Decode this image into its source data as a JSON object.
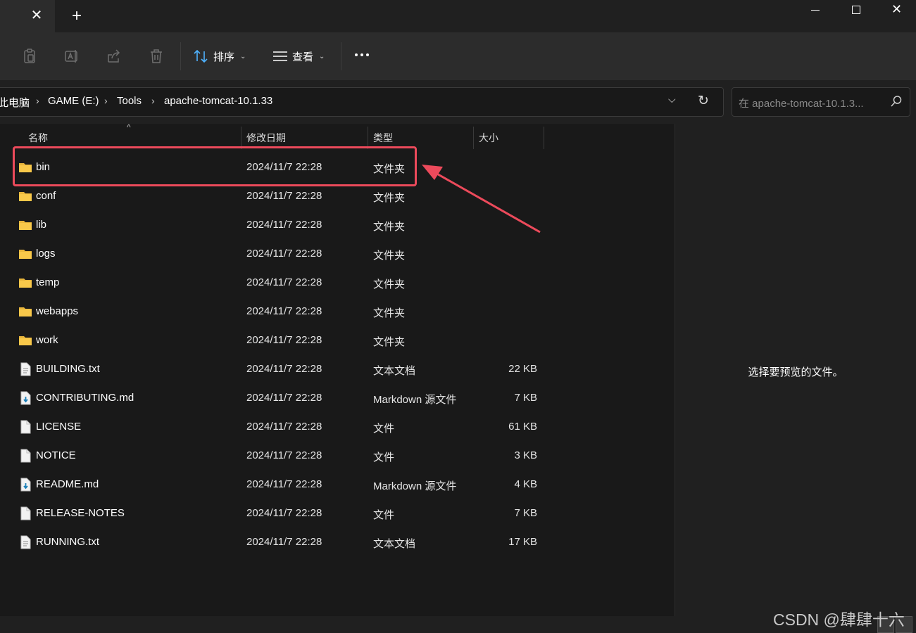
{
  "window": {
    "new_tab_label": "+",
    "close_tab_label": "✕"
  },
  "toolbar": {
    "sort_label": "排序",
    "view_label": "查看"
  },
  "address": {
    "crumbs": [
      "此电脑",
      "GAME (E:)",
      "Tools",
      "apache-tomcat-10.1.33"
    ],
    "search_placeholder": "在 apache-tomcat-10.1.3..."
  },
  "columns": {
    "name": "名称",
    "date": "修改日期",
    "type": "类型",
    "size": "大小"
  },
  "files": [
    {
      "name": "bin",
      "date": "2024/11/7 22:28",
      "type": "文件夹",
      "size": "",
      "icon": "folder-icon"
    },
    {
      "name": "conf",
      "date": "2024/11/7 22:28",
      "type": "文件夹",
      "size": "",
      "icon": "folder-icon"
    },
    {
      "name": "lib",
      "date": "2024/11/7 22:28",
      "type": "文件夹",
      "size": "",
      "icon": "folder-icon"
    },
    {
      "name": "logs",
      "date": "2024/11/7 22:28",
      "type": "文件夹",
      "size": "",
      "icon": "folder-icon"
    },
    {
      "name": "temp",
      "date": "2024/11/7 22:28",
      "type": "文件夹",
      "size": "",
      "icon": "folder-icon"
    },
    {
      "name": "webapps",
      "date": "2024/11/7 22:28",
      "type": "文件夹",
      "size": "",
      "icon": "folder-icon"
    },
    {
      "name": "work",
      "date": "2024/11/7 22:28",
      "type": "文件夹",
      "size": "",
      "icon": "folder-icon"
    },
    {
      "name": "BUILDING.txt",
      "date": "2024/11/7 22:28",
      "type": "文本文档",
      "size": "22 KB",
      "icon": "text-file-icon"
    },
    {
      "name": "CONTRIBUTING.md",
      "date": "2024/11/7 22:28",
      "type": "Markdown 源文件",
      "size": "7 KB",
      "icon": "markdown-file-icon"
    },
    {
      "name": "LICENSE",
      "date": "2024/11/7 22:28",
      "type": "文件",
      "size": "61 KB",
      "icon": "file-icon"
    },
    {
      "name": "NOTICE",
      "date": "2024/11/7 22:28",
      "type": "文件",
      "size": "3 KB",
      "icon": "file-icon"
    },
    {
      "name": "README.md",
      "date": "2024/11/7 22:28",
      "type": "Markdown 源文件",
      "size": "4 KB",
      "icon": "markdown-file-icon"
    },
    {
      "name": "RELEASE-NOTES",
      "date": "2024/11/7 22:28",
      "type": "文件",
      "size": "7 KB",
      "icon": "file-icon"
    },
    {
      "name": "RUNNING.txt",
      "date": "2024/11/7 22:28",
      "type": "文本文档",
      "size": "17 KB",
      "icon": "text-file-icon"
    }
  ],
  "preview": {
    "text": "选择要预览的文件。"
  },
  "watermark": "CSDN @肆肆十六",
  "colors": {
    "highlight": "#ec4a5b",
    "folder": "#f8c84a"
  }
}
